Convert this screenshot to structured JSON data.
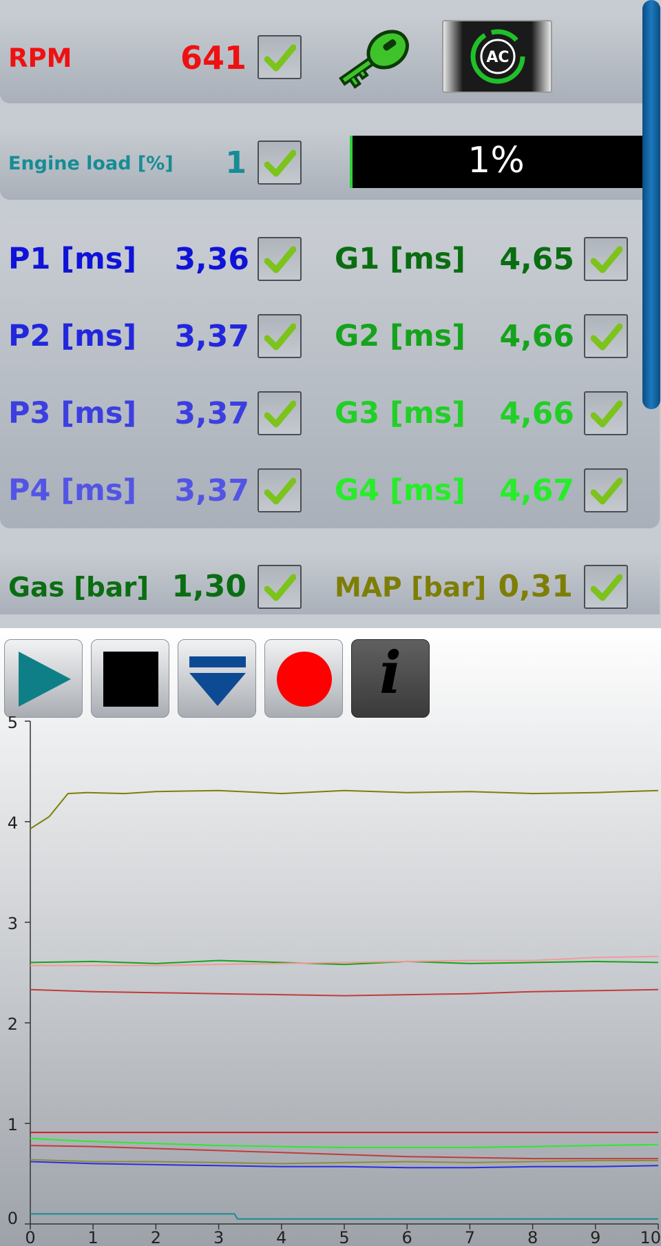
{
  "rpm": {
    "label": "RPM",
    "value": "641"
  },
  "engine_load": {
    "label": "Engine load [%]",
    "value": "1",
    "bar_text": "1%",
    "percent": 1
  },
  "injectors": [
    {
      "label": "P1 [ms]",
      "value": "3,36",
      "color": "#0f13d7"
    },
    {
      "label": "P2 [ms]",
      "value": "3,37",
      "color": "#2227dc"
    },
    {
      "label": "P3 [ms]",
      "value": "3,37",
      "color": "#3b3fe0"
    },
    {
      "label": "P4 [ms]",
      "value": "3,37",
      "color": "#5255e4"
    }
  ],
  "gas_injectors": [
    {
      "label": "G1 [ms]",
      "value": "4,65",
      "color": "#0b6d12"
    },
    {
      "label": "G2 [ms]",
      "value": "4,66",
      "color": "#15a31c"
    },
    {
      "label": "G3 [ms]",
      "value": "4,66",
      "color": "#21cf27"
    },
    {
      "label": "G4 [ms]",
      "value": "4,67",
      "color": "#27ec2a"
    }
  ],
  "gas_pressure": {
    "label": "Gas [bar]",
    "value": "1,30",
    "color": "#0b6d12"
  },
  "map_pressure": {
    "label": "MAP [bar]",
    "value": "0,31",
    "color": "#7e7e07"
  },
  "toolbar": {
    "icons": [
      "play-icon",
      "stop-icon",
      "download-icon",
      "record-icon",
      "info-icon"
    ],
    "info_glyph": "i"
  },
  "colors": {
    "rpm": "#ee1111",
    "engine_load": "#178c94",
    "play": "#0f7f87",
    "record": "#ff0000",
    "download": "#0d4a94"
  },
  "chart_data": {
    "type": "line",
    "x_ticks": [
      "0",
      "1",
      "2",
      "3",
      "4",
      "5",
      "6",
      "7",
      "8",
      "9",
      "10"
    ],
    "y_ticks": [
      "0",
      "1",
      "2",
      "3",
      "4",
      "5"
    ],
    "xlim": [
      0,
      10
    ],
    "ylim": [
      0,
      5
    ],
    "grid": false,
    "series": [
      {
        "color": "#7e7e07",
        "x": [
          0,
          0.3,
          0.6,
          0.9,
          1.5,
          2,
          3,
          4,
          5,
          6,
          7,
          8,
          9,
          10
        ],
        "y": [
          3.93,
          4.05,
          4.28,
          4.29,
          4.28,
          4.3,
          4.31,
          4.28,
          4.31,
          4.29,
          4.3,
          4.28,
          4.29,
          4.31
        ]
      },
      {
        "color": "#15a31c",
        "x": [
          0,
          1,
          2,
          3,
          4,
          5,
          6,
          7,
          8,
          9,
          10
        ],
        "y": [
          2.6,
          2.61,
          2.59,
          2.62,
          2.6,
          2.58,
          2.61,
          2.59,
          2.6,
          2.61,
          2.6
        ]
      },
      {
        "color": "#f29a9a",
        "x": [
          0,
          1,
          2,
          3,
          4,
          5,
          6,
          7,
          8,
          9,
          10
        ],
        "y": [
          2.57,
          2.57,
          2.57,
          2.58,
          2.59,
          2.6,
          2.61,
          2.62,
          2.62,
          2.65,
          2.66
        ]
      },
      {
        "color": "#c23a3a",
        "x": [
          0,
          1,
          2,
          3,
          4,
          5,
          6,
          7,
          8,
          9,
          10
        ],
        "y": [
          2.33,
          2.31,
          2.3,
          2.29,
          2.28,
          2.27,
          2.28,
          2.29,
          2.31,
          2.32,
          2.33
        ]
      },
      {
        "color": "#d01c1c",
        "x": [
          0,
          10
        ],
        "y": [
          0.91,
          0.91
        ]
      },
      {
        "color": "#27ec2a",
        "x": [
          0,
          1,
          2,
          3,
          4,
          5,
          6,
          7,
          8,
          9,
          10
        ],
        "y": [
          0.85,
          0.82,
          0.8,
          0.78,
          0.77,
          0.76,
          0.76,
          0.76,
          0.77,
          0.78,
          0.79
        ]
      },
      {
        "color": "#c23a3a",
        "x": [
          0,
          1,
          2,
          3,
          4,
          5,
          6,
          7,
          8,
          9,
          10
        ],
        "y": [
          0.78,
          0.77,
          0.75,
          0.73,
          0.71,
          0.69,
          0.67,
          0.66,
          0.65,
          0.65,
          0.65
        ]
      },
      {
        "color": "#8f8a40",
        "x": [
          0,
          1,
          2,
          3,
          4,
          5,
          6,
          7,
          8,
          9,
          10
        ],
        "y": [
          0.64,
          0.62,
          0.62,
          0.61,
          0.6,
          0.61,
          0.62,
          0.61,
          0.62,
          0.63,
          0.63
        ]
      },
      {
        "color": "#2a2ee0",
        "x": [
          0,
          1,
          2,
          3,
          4,
          5,
          6,
          7,
          8,
          9,
          10
        ],
        "y": [
          0.62,
          0.6,
          0.59,
          0.58,
          0.57,
          0.57,
          0.56,
          0.56,
          0.57,
          0.57,
          0.58
        ]
      },
      {
        "color": "#178c94",
        "x": [
          0,
          3.25,
          3.3,
          10
        ],
        "y": [
          0.1,
          0.1,
          0.05,
          0.05
        ]
      }
    ]
  }
}
